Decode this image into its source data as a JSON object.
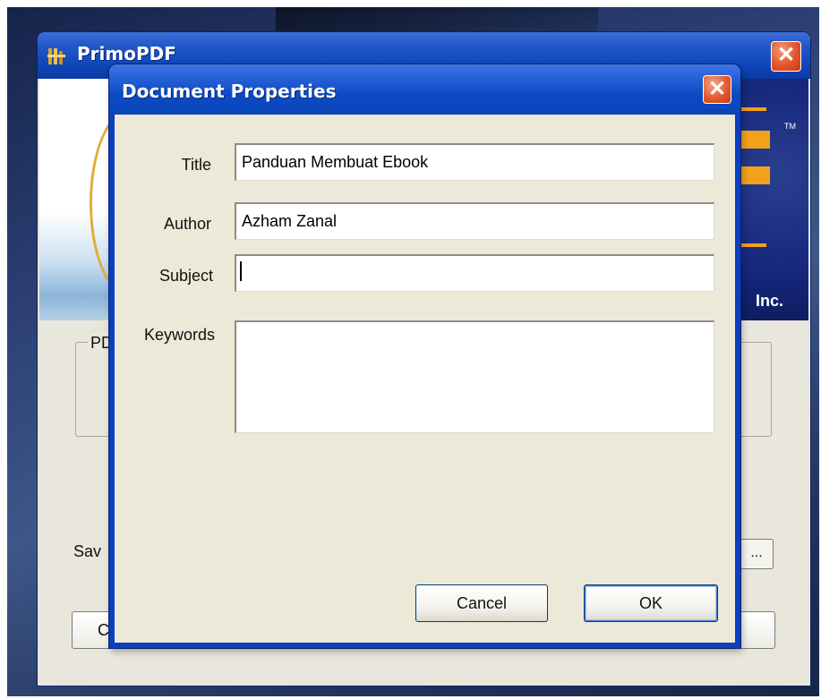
{
  "primo_window": {
    "title": "PrimoPDF",
    "close_glyph": "✕",
    "banner_text": "Inc.",
    "banner_tm": "TM",
    "group_label_fragment": "PD",
    "save_label_fragment": "Sav",
    "browse_label": "...",
    "left_button_fragment": "C"
  },
  "dialog": {
    "title": "Document Properties",
    "close_glyph": "✕",
    "fields": {
      "title_label": "Title",
      "title_value": "Panduan Membuat Ebook",
      "author_label": "Author",
      "author_value": "Azham Zanal",
      "subject_label": "Subject",
      "subject_value": "",
      "keywords_label": "Keywords",
      "keywords_value": ""
    },
    "buttons": {
      "cancel": "Cancel",
      "ok": "OK"
    }
  },
  "colors": {
    "xp_blue": "#0b3fc0",
    "dialog_face": "#ece9d8",
    "close_red": "#e45a31",
    "banner_orange": "#f4a11a"
  }
}
